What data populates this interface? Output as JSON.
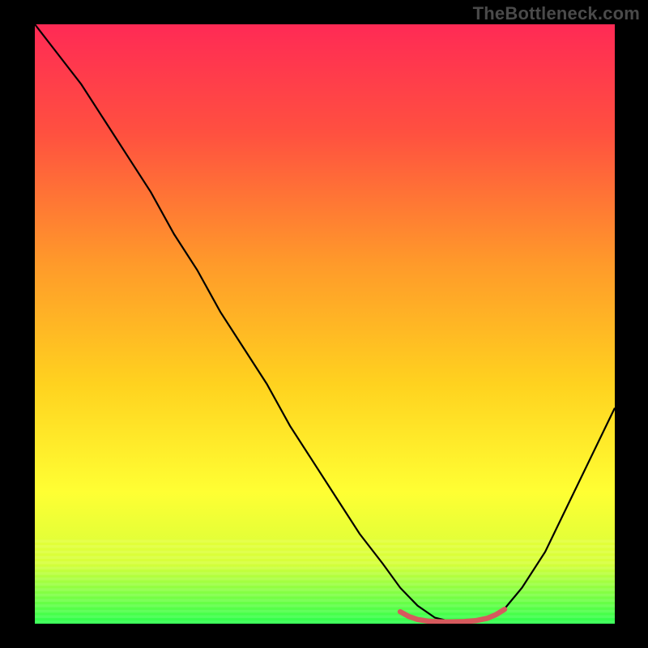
{
  "watermark": "TheBottleneck.com",
  "chart_data": {
    "type": "line",
    "title": "",
    "xlabel": "",
    "ylabel": "",
    "xlim": [
      0,
      100
    ],
    "ylim": [
      0,
      100
    ],
    "gradient_stops": [
      {
        "offset": 0.0,
        "color": "#ff2a55"
      },
      {
        "offset": 0.18,
        "color": "#ff5040"
      },
      {
        "offset": 0.4,
        "color": "#ff9a2a"
      },
      {
        "offset": 0.6,
        "color": "#ffd21f"
      },
      {
        "offset": 0.78,
        "color": "#ffff33"
      },
      {
        "offset": 0.9,
        "color": "#d6ff3a"
      },
      {
        "offset": 1.0,
        "color": "#2bff4d"
      }
    ],
    "series": [
      {
        "name": "bottleneck-curve",
        "color": "#000000",
        "width": 2.2,
        "x": [
          0,
          4,
          8,
          12,
          16,
          20,
          24,
          28,
          32,
          36,
          40,
          44,
          48,
          52,
          56,
          60,
          63,
          66,
          69,
          72,
          75,
          78,
          81,
          84,
          88,
          92,
          96,
          100
        ],
        "y": [
          100,
          95,
          90,
          84,
          78,
          72,
          65,
          59,
          52,
          46,
          40,
          33,
          27,
          21,
          15,
          10,
          6,
          3,
          1,
          0.3,
          0.3,
          0.8,
          2.5,
          6,
          12,
          20,
          28,
          36
        ]
      },
      {
        "name": "optimal-range",
        "color": "#d65a5d",
        "width": 6.5,
        "x": [
          63,
          64.5,
          66,
          68,
          70,
          72,
          74,
          76,
          78,
          79.5,
          81
        ],
        "y": [
          2.0,
          1.2,
          0.7,
          0.4,
          0.3,
          0.3,
          0.35,
          0.5,
          0.9,
          1.5,
          2.4
        ]
      }
    ]
  }
}
